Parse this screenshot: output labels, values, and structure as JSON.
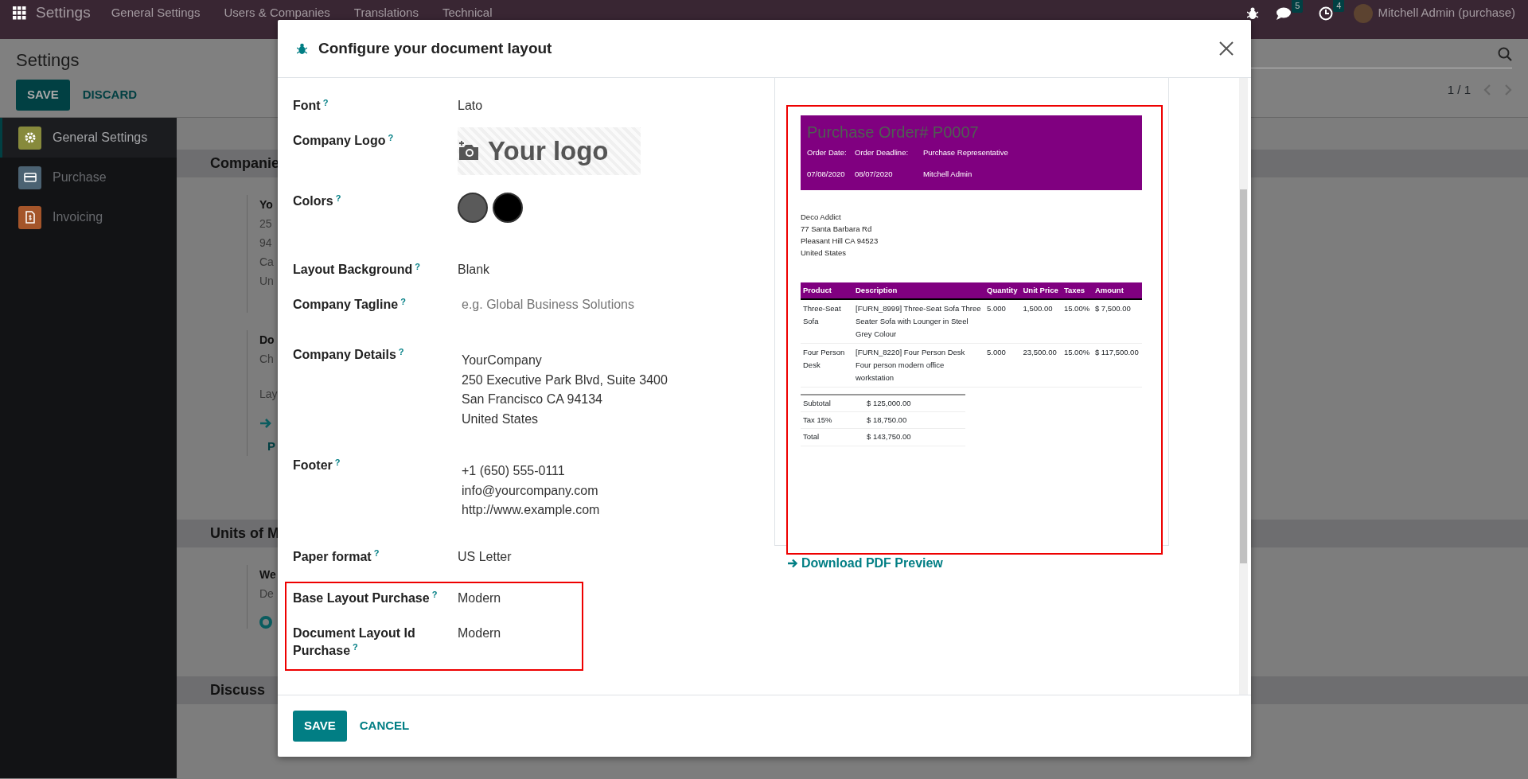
{
  "navbar": {
    "app_title": "Settings",
    "menu": [
      "General Settings",
      "Users & Companies",
      "Translations",
      "Technical"
    ],
    "messages_count": "5",
    "activities_count": "4",
    "user": "Mitchell Admin (purchase)"
  },
  "control_panel": {
    "title": "Settings",
    "save": "SAVE",
    "discard": "DISCARD",
    "pager": "1 / 1"
  },
  "sidebar": {
    "items": [
      {
        "label": "General Settings",
        "selected": true,
        "color": "#878a3c",
        "kind": "gear"
      },
      {
        "label": "Purchase",
        "selected": false,
        "color": "#4b6272",
        "kind": "card"
      },
      {
        "label": "Invoicing",
        "selected": false,
        "color": "#a4552a",
        "kind": "invoice"
      }
    ]
  },
  "sections": [
    {
      "title": "Companie",
      "blocks": [
        {
          "heading": "Yo",
          "lines": [
            "25",
            "94",
            "Ca",
            "Un"
          ],
          "kind": "plain"
        },
        {
          "heading": "Do",
          "lines": [
            "Ch",
            "Lay"
          ],
          "kind": "link",
          "link": "P"
        }
      ]
    },
    {
      "title": "Units of M",
      "blocks": [
        {
          "heading": "We",
          "lines": [
            "De"
          ],
          "kind": "radio",
          "selected": true
        }
      ]
    },
    {
      "title": "Discuss"
    }
  ],
  "dialog": {
    "title": "Configure your document layout",
    "fields": [
      {
        "label": "Font",
        "help": "?",
        "kind": "text",
        "value": "Lato"
      },
      {
        "label": "Company Logo",
        "help": "?",
        "kind": "logo",
        "value": "Your logo"
      },
      {
        "label": "Colors",
        "help": "?",
        "kind": "colors",
        "colors": [
          {
            "color": "#5a5a5a"
          },
          {
            "color": "#000000"
          }
        ]
      },
      {
        "label": "Layout Background",
        "help": "?",
        "kind": "text",
        "value": "Blank"
      },
      {
        "label": "Company Tagline",
        "help": "?",
        "kind": "input",
        "placeholder": "e.g. Global Business Solutions"
      },
      {
        "label": "Company Details",
        "help": "?",
        "kind": "multiline",
        "lines": [
          "YourCompany",
          "250 Executive Park Blvd, Suite 3400",
          "San Francisco CA 94134",
          "United States"
        ]
      },
      {
        "label": "Footer",
        "help": "?",
        "kind": "multiline",
        "lines": [
          "+1 (650) 555-0111",
          "info@yourcompany.com",
          "http://www.example.com"
        ]
      },
      {
        "label": "Paper format",
        "help": "?",
        "kind": "text",
        "value": "US Letter"
      },
      {
        "label": "Base Layout Purchase",
        "help": "?",
        "kind": "text",
        "value": "Modern"
      },
      {
        "label": "Document Layout Id Purchase",
        "help": "?",
        "kind": "text",
        "value": "Modern"
      }
    ],
    "preview": {
      "title": "Purchase Order# P0007",
      "info": [
        {
          "label": "Order Date:",
          "value": "07/08/2020"
        },
        {
          "label": "Order Deadline:",
          "value": "08/07/2020"
        },
        {
          "label": "Purchase Representative",
          "value": "Mitchell Admin"
        }
      ],
      "address": [
        "Deco Addict",
        "77 Santa Barbara Rd",
        "Pleasant Hill CA 94523",
        "United States"
      ],
      "columns": [
        "Product",
        "Description",
        "Quantity",
        "Unit Price",
        "Taxes",
        "Amount"
      ],
      "rows": [
        [
          "Three-Seat Sofa",
          "[FURN_8999] Three-Seat Sofa Three Seater Sofa with Lounger in Steel Grey Colour",
          "5.000",
          "1,500.00",
          "15.00%",
          "$ 7,500.00"
        ],
        [
          "Four Person Desk",
          "[FURN_8220] Four Person Desk Four person modern office workstation",
          "5.000",
          "23,500.00",
          "15.00%",
          "$ 117,500.00"
        ]
      ],
      "totals": [
        {
          "label": "Subtotal",
          "value": "$ 125,000.00"
        },
        {
          "label": "Tax 15%",
          "value": "$ 18,750.00"
        },
        {
          "label": "Total",
          "value": "$ 143,750.00"
        }
      ]
    },
    "download_link": "Download PDF Preview",
    "buttons": {
      "save": "SAVE",
      "cancel": "CANCEL"
    }
  }
}
